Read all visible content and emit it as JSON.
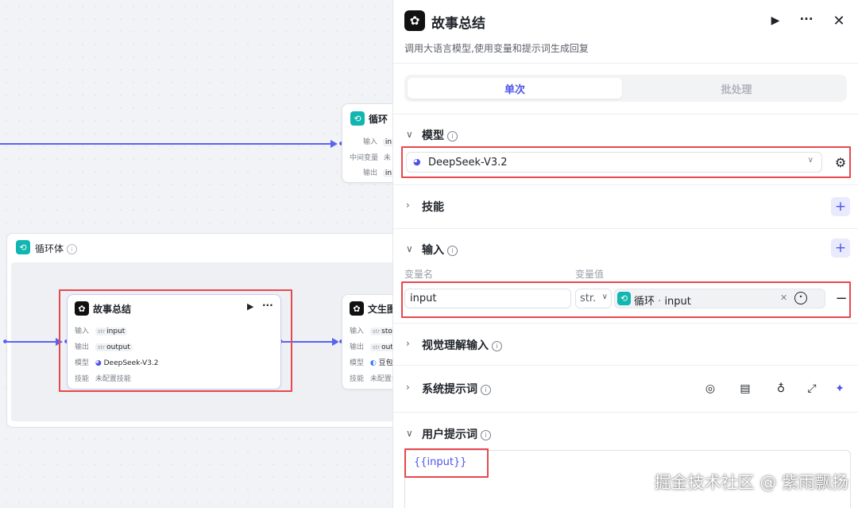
{
  "canvas": {
    "loop_node": {
      "title": "循环",
      "rows": [
        {
          "label": "输入",
          "value": "in"
        },
        {
          "label": "中间变量",
          "value": "未"
        },
        {
          "label": "输出",
          "value": "in"
        }
      ]
    },
    "loop_body": {
      "title": "循环体"
    },
    "summary_node": {
      "title": "故事总结",
      "input_label": "输入",
      "input_type": "str",
      "input_value": "input",
      "output_label": "输出",
      "output_type": "str",
      "output_value": "output",
      "model_label": "模型",
      "model_value": "DeepSeek-V3.2",
      "skill_label": "技能",
      "skill_value": "未配置技能"
    },
    "text_node": {
      "title": "文生图",
      "input_label": "输入",
      "input_type": "str",
      "input_value": "sto",
      "output_label": "输出",
      "output_type": "str",
      "output_value": "out",
      "model_label": "模型",
      "model_value": "豆包",
      "skill_label": "技能",
      "skill_value": "未配置技能"
    }
  },
  "panel": {
    "title": "故事总结",
    "subtitle": "调用大语言模型,使用变量和提示词生成回复",
    "tabs": [
      {
        "label": "单次",
        "active": true
      },
      {
        "label": "批处理",
        "active": false
      }
    ],
    "model_section": {
      "title": "模型",
      "selected_model": "DeepSeek-V3.2"
    },
    "skills_section": {
      "title": "技能"
    },
    "input_section": {
      "title": "输入",
      "col_name": "变量名",
      "col_value": "变量值",
      "var_name": "input",
      "var_type": "str.",
      "ref_node": "循环",
      "ref_sep": "·",
      "ref_var": "input"
    },
    "vision_section": {
      "title": "视觉理解输入"
    },
    "system_prompt_section": {
      "title": "系统提示词"
    },
    "user_prompt_section": {
      "title": "用户提示词",
      "content": "{{input}}"
    }
  },
  "watermark": "掘金技术社区 @ 紫雨飘扬",
  "colors": {
    "accent": "#4d53e8",
    "edge": "#5b63f0",
    "teal": "#11b6b0",
    "highlight": "#e8484d"
  }
}
